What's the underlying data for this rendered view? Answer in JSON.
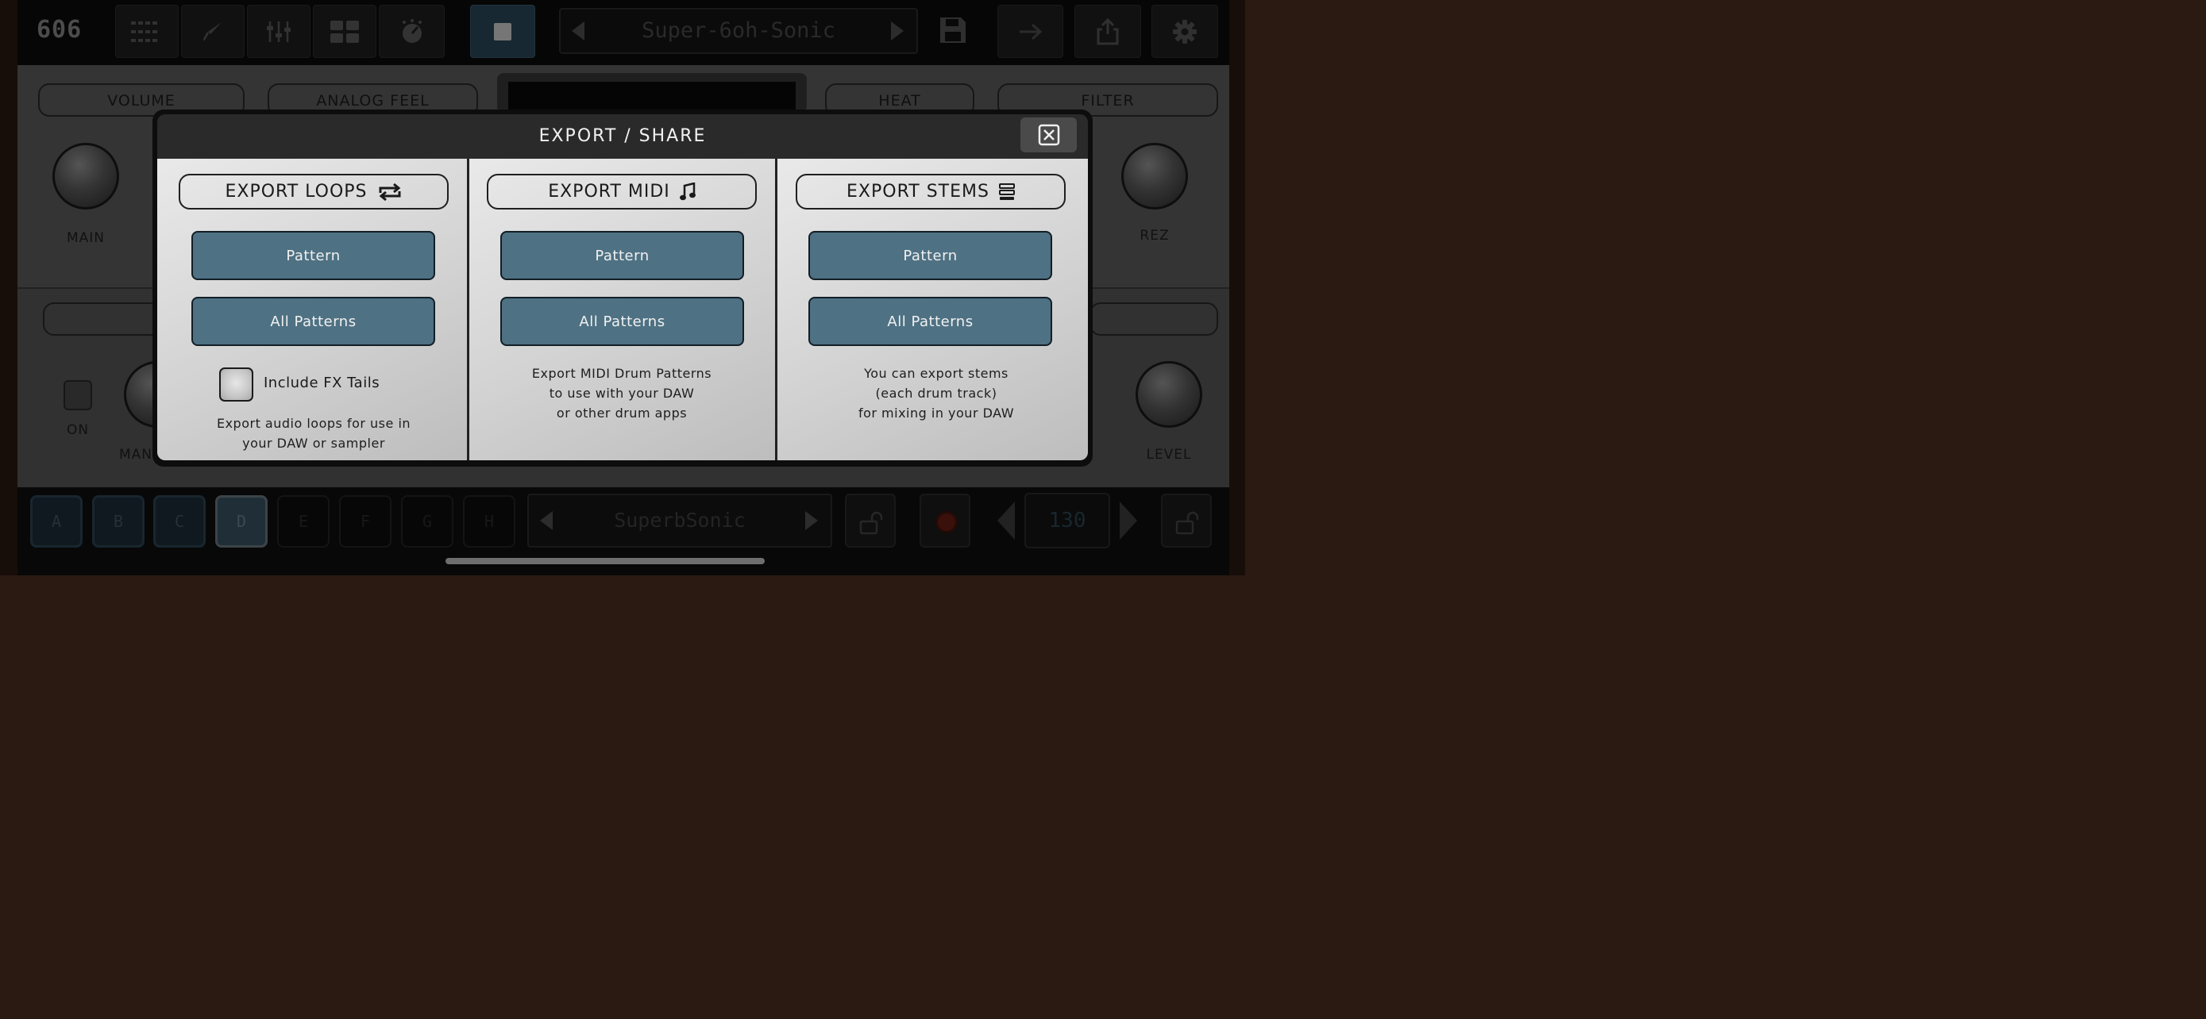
{
  "app": {
    "logo": "606",
    "preset_name": "Super-6oh-Sonic",
    "kit_name": "SuperbSonic",
    "bpm": "130"
  },
  "toolbar": {
    "icons": [
      "sequencer-grid-icon",
      "brush-icon",
      "mixer-sliders-icon",
      "pads-grid-icon",
      "knob-icon",
      "stop-icon",
      "save-icon",
      "arrow-right-icon",
      "share-icon",
      "gear-icon"
    ]
  },
  "synth": {
    "section_labels": [
      "VOLUME",
      "ANALOG FEEL",
      "HEAT",
      "FILTER"
    ],
    "knob_labels": {
      "main": "MAIN",
      "rez": "REZ",
      "on": "ON",
      "man": "MAN",
      "level": "LEVEL"
    }
  },
  "patterns": [
    "A",
    "B",
    "C",
    "D",
    "E",
    "F",
    "G",
    "H"
  ],
  "active_pattern": "D",
  "modal": {
    "title": "EXPORT / SHARE",
    "columns": [
      {
        "heading": "EXPORT LOOPS",
        "icon": "loop-arrows-icon",
        "pattern_label": "Pattern",
        "all_label": "All Patterns",
        "checkbox_label": "Include FX Tails",
        "desc_lines": [
          "Export audio loops for use in",
          "your DAW or sampler"
        ]
      },
      {
        "heading": "EXPORT MIDI",
        "icon": "music-note-icon",
        "pattern_label": "Pattern",
        "all_label": "All Patterns",
        "desc_lines": [
          "Export MIDI Drum Patterns",
          "to use with your DAW",
          "or other drum apps"
        ]
      },
      {
        "heading": "EXPORT STEMS",
        "icon": "stems-stack-icon",
        "pattern_label": "Pattern",
        "all_label": "All Patterns",
        "desc_lines": [
          "You can export stems",
          "(each drum track)",
          "for mixing in your DAW"
        ]
      }
    ]
  },
  "colors": {
    "accent_blue": "#4e7183",
    "modal_header": "#2a2a2a",
    "panel_grey": "#5f5f5f"
  }
}
